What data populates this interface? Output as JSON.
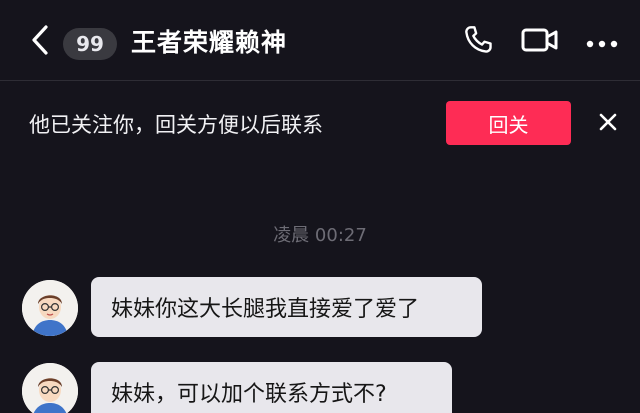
{
  "header": {
    "badge_count": "99",
    "title": "王者荣耀赖神",
    "icons": [
      "back-icon",
      "phone-icon",
      "video-camera-icon",
      "more-icon"
    ]
  },
  "banner": {
    "text": "他已关注你，回关方便以后联系",
    "button_label": "回关",
    "button_color": "#fe2c55",
    "close_icon": "close-icon"
  },
  "chat": {
    "timestamp": "凌晨 00:27",
    "messages": [
      {
        "sender": "other",
        "text": "妹妹你这大长腿我直接爱了爱了"
      },
      {
        "sender": "other",
        "text": "妹妹，可以加个联系方式不?"
      }
    ]
  },
  "colors": {
    "background": "#15141c",
    "bubble": "#e8e7ec",
    "accent": "#fe2c55"
  }
}
